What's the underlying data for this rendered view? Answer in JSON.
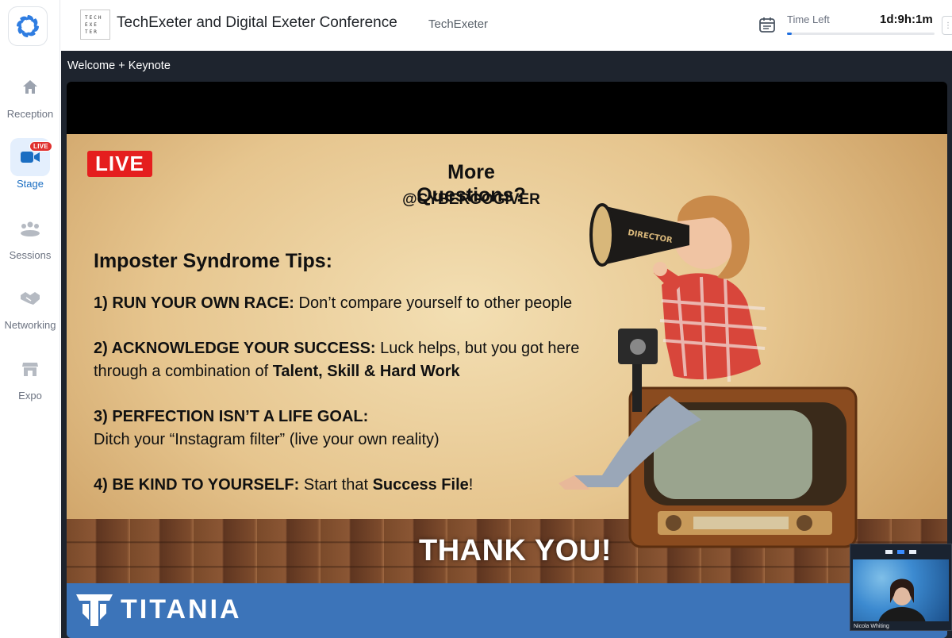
{
  "sidebar": {
    "items": [
      {
        "label": "Reception",
        "icon": "home-icon"
      },
      {
        "label": "Stage",
        "icon": "video-camera-icon",
        "badge": "LIVE"
      },
      {
        "label": "Sessions",
        "icon": "people-group-icon"
      },
      {
        "label": "Networking",
        "icon": "handshake-icon"
      },
      {
        "label": "Expo",
        "icon": "storefront-icon"
      }
    ],
    "active": "Stage"
  },
  "header": {
    "logo_lines": [
      "TECH",
      "EXE",
      "TER"
    ],
    "title": "TechExeter and Digital Exeter Conference",
    "organizer": "TechExeter",
    "time_left_label": "Time Left",
    "time_left_value": "1d:9h:1m",
    "time_progress": 0.03
  },
  "stage": {
    "session_title": "Welcome + Keynote",
    "slide": {
      "live_tag": "LIVE",
      "more_questions": "More Questions?",
      "handle": "@CYBERGOGIVER",
      "tips_title": "Imposter Syndrome Tips:",
      "tips": [
        {
          "head": "1) RUN YOUR OWN RACE:",
          "body": " Don’t compare yourself to other people"
        },
        {
          "head": "2) ACKNOWLEDGE YOUR SUCCESS:",
          "body": " Luck helps, but you got here",
          "line2_pre": "through a combination of ",
          "line2_bold": "Talent, Skill & Hard Work"
        },
        {
          "head": "3) PERFECTION ISN’T A LIFE GOAL:",
          "line2": "Ditch your “Instagram filter” (live your own reality)"
        },
        {
          "head": "4) BE KIND TO YOURSELF:",
          "body": " Start that ",
          "bold_end": "Success File",
          "end": "!"
        }
      ],
      "megaphone_text": "DIRECTOR",
      "thank_you": "THANK YOU!",
      "brand": "TITANIA"
    },
    "self_view_name": "Nicola Whiting"
  },
  "colors": {
    "accent": "#1b6ec2",
    "live_red": "#e51e1e",
    "brand_blue": "#3c74b9",
    "stage_bg": "#1e242e"
  }
}
